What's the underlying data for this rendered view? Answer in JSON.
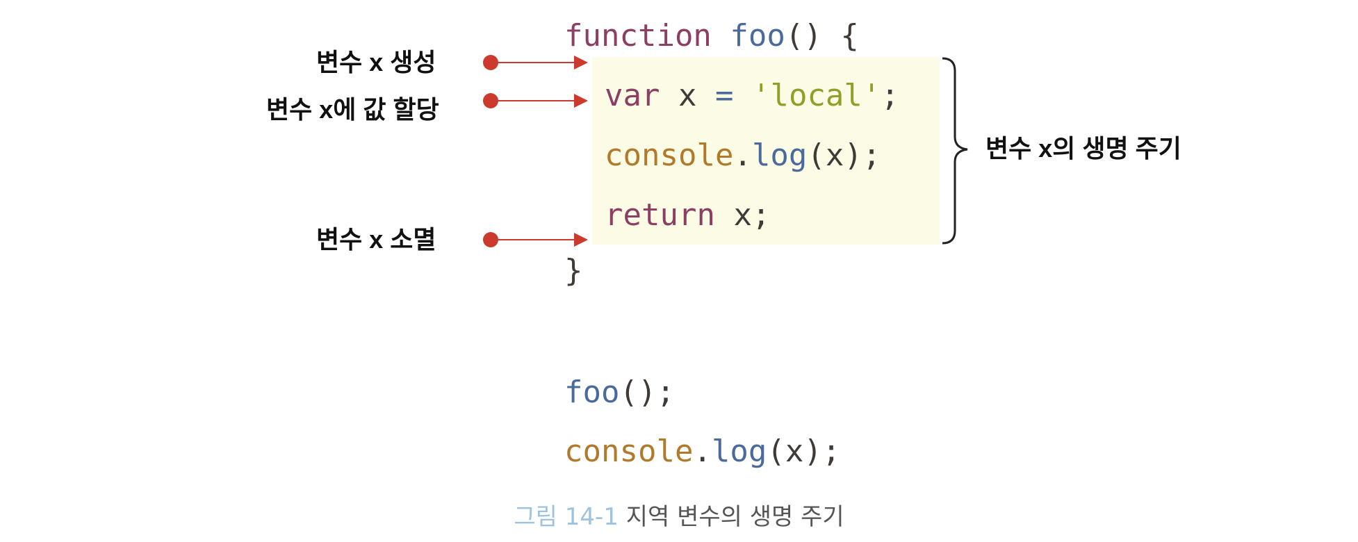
{
  "code_lines": [
    {
      "tokens": [
        {
          "t": "function",
          "c": "kw"
        },
        {
          "t": " ",
          "c": "plain"
        },
        {
          "t": "foo",
          "c": "fn"
        },
        {
          "t": "() {",
          "c": "plain"
        }
      ]
    },
    {
      "tokens": [
        {
          "t": "var",
          "c": "kw"
        },
        {
          "t": " x ",
          "c": "plain"
        },
        {
          "t": "=",
          "c": "op"
        },
        {
          "t": " ",
          "c": "plain"
        },
        {
          "t": "'local'",
          "c": "str"
        },
        {
          "t": ";",
          "c": "plain"
        }
      ]
    },
    {
      "tokens": [
        {
          "t": "console",
          "c": "obj"
        },
        {
          "t": ".",
          "c": "plain"
        },
        {
          "t": "log",
          "c": "fn"
        },
        {
          "t": "(x);",
          "c": "plain"
        }
      ]
    },
    {
      "tokens": [
        {
          "t": "return",
          "c": "kw"
        },
        {
          "t": " x;",
          "c": "plain"
        }
      ]
    },
    {
      "tokens": [
        {
          "t": "}",
          "c": "plain"
        }
      ]
    },
    {
      "tokens": [
        {
          "t": "foo",
          "c": "fn"
        },
        {
          "t": "();",
          "c": "plain"
        }
      ]
    },
    {
      "tokens": [
        {
          "t": "console",
          "c": "obj"
        },
        {
          "t": ".",
          "c": "plain"
        },
        {
          "t": "log",
          "c": "fn"
        },
        {
          "t": "(x);",
          "c": "plain"
        }
      ]
    }
  ],
  "annotations": {
    "create": "변수 x 생성",
    "assign": "변수 x에 값 할당",
    "destroy": "변수 x 소멸",
    "lifetime": "변수 x의 생명 주기"
  },
  "caption": {
    "number": "그림 14-1",
    "text": "지역 변수의 생명 주기"
  },
  "colors": {
    "arrow": "#cc3a2e",
    "highlight": "#fcfbe6",
    "keyword": "#8a3f63",
    "function_name": "#4b6a9c",
    "object": "#b07a2a",
    "string": "#8f9f2a",
    "caption_number": "#9cc3df"
  }
}
